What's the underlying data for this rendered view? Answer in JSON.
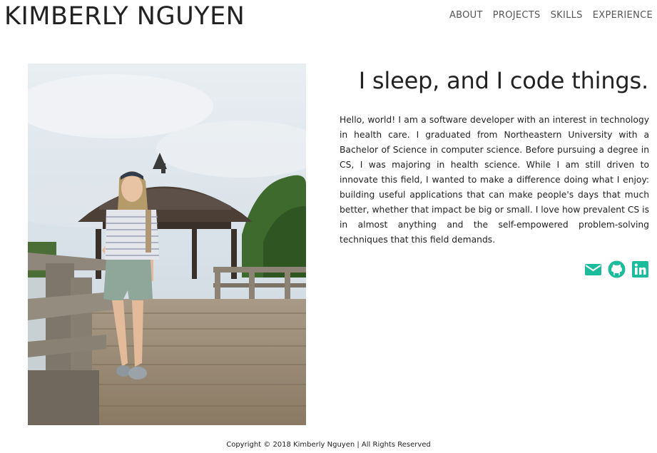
{
  "header": {
    "site_title": "KIMBERLY NGUYEN",
    "nav": [
      {
        "label": "ABOUT"
      },
      {
        "label": "PROJECTS"
      },
      {
        "label": "SKILLS"
      },
      {
        "label": "EXPERIENCE"
      }
    ]
  },
  "main": {
    "headline": "I sleep, and I code things.",
    "bio": "Hello, world! I am a software developer with an interest in technology in health care. I graduated from Northeastern University with a Bachelor of Science in computer science. Before pursuing a degree in CS, I was majoring in health science. While I am still driven to innovate this field, I wanted to make a difference doing what I enjoy: building useful applications that can make people's days that much better, whether that impact be big or small. I love how prevalent CS is in almost anything and the self-empowered problem-solving techniques that this field demands.",
    "socials": [
      {
        "icon": "envelope-icon"
      },
      {
        "icon": "github-icon"
      },
      {
        "icon": "linkedin-icon"
      }
    ],
    "accent_color": "#1ABC9C"
  },
  "footer": {
    "copyright": "Copyright © 2018 Kimberly Nguyen | All Rights Reserved"
  }
}
